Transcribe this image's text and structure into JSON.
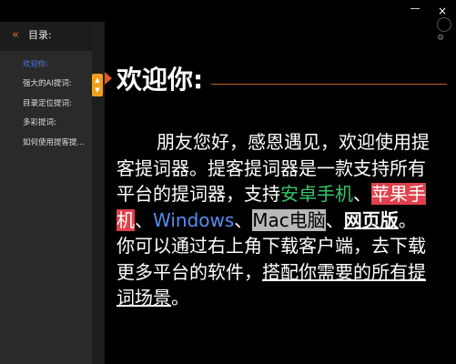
{
  "window": {
    "minimize_icon": "minimize-icon",
    "close_label": "×"
  },
  "sidebar": {
    "collapse_glyph": "«",
    "title": "目录:",
    "items": [
      {
        "label": "欢迎你:",
        "active": true
      },
      {
        "label": "强大的AI提词:",
        "active": false
      },
      {
        "label": "目录定位提词:",
        "active": false
      },
      {
        "label": "多彩提词:",
        "active": false
      },
      {
        "label": "如何使用提客提...",
        "active": false
      }
    ]
  },
  "scroll_control": {
    "up": "▲",
    "down": "▼"
  },
  "main": {
    "heading": "欢迎你:",
    "p_plain1": "朋友您好，感恩遇见，欢迎使用提客提词器。提客提词器是一款支持所有平台的提词器，支持",
    "p_green": "安卓手机",
    "p_sep1": "、",
    "p_red": "苹果手机",
    "p_sep2": "、",
    "p_blue": "Windows",
    "p_sep3": "、",
    "p_gray": "Mac电脑",
    "p_sep4": "、",
    "p_bold": "网页版",
    "p_plain2": "。你可以通过右上角下载客户端，去下载更多平台的软件，",
    "p_underline": "搭配你需要的所有提词场景",
    "p_end": "。"
  },
  "colors": {
    "accent_orange": "#e05a20",
    "active_blue": "#3f77f2",
    "green": "#35c76a",
    "red": "#e0414b",
    "blue": "#5a8bf2"
  }
}
